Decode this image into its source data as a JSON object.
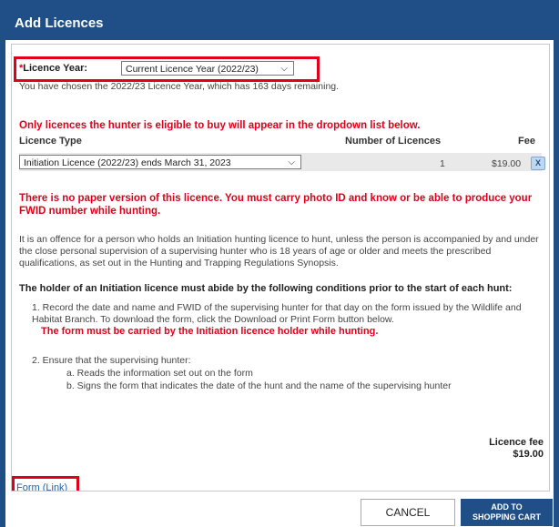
{
  "dialog": {
    "title": "Add Licences"
  },
  "licence_year": {
    "required_marker": "*",
    "label": "Licence Year:",
    "selected": "Current Licence Year (2022/23)",
    "chosen_text": "You have chosen the 2022/23 Licence Year, which has 163 days remaining."
  },
  "eligibility_notice": "Only licences the hunter is eligible to buy will appear in the dropdown list below.",
  "table": {
    "headers": {
      "type": "Licence Type",
      "number": "Number of Licences",
      "fee": "Fee"
    },
    "row": {
      "type": "Initiation Licence (2022/23) ends March 31, 2023",
      "number": "1",
      "fee": "$19.00",
      "remove": "X"
    }
  },
  "warning": "There is no paper version of this licence. You must carry photo ID and know or be able to produce your FWID number while hunting.",
  "offence_text": "It is an offence for a person who holds an Initiation hunting licence to hunt, unless the person is accompanied by and under the close personal supervision of a supervising hunter who is 18 years of age or older and meets the prescribed qualifications, as set out in the Hunting and Trapping Regulations Synopsis.",
  "conditions": {
    "heading": "The holder of an Initiation licence must abide by the following conditions prior to the start of each hunt:",
    "item1_text": "1. Record the date and name and FWID of the supervising hunter for that day on the form issued by the Wildlife and Habitat Branch. To download the form, click the Download or Print Form button below.",
    "item1_warning": "The form must be carried by the Initiation licence holder while hunting.",
    "item2_text": "2. Ensure that the supervising hunter:",
    "item2_a": "a. Reads the information set out on the form",
    "item2_b": "b. Signs the form that indicates the date of the hunt and the name of the supervising hunter"
  },
  "licence_fee": {
    "label": "Licence fee",
    "amount": "$19.00"
  },
  "form_link": "Form (Link)",
  "buttons": {
    "cancel": "CANCEL",
    "add": "ADD TO SHOPPING CART"
  },
  "colors": {
    "header_blue": "#1f4f86",
    "warning_red": "#e0001a",
    "link_blue": "#1f5fa8"
  }
}
